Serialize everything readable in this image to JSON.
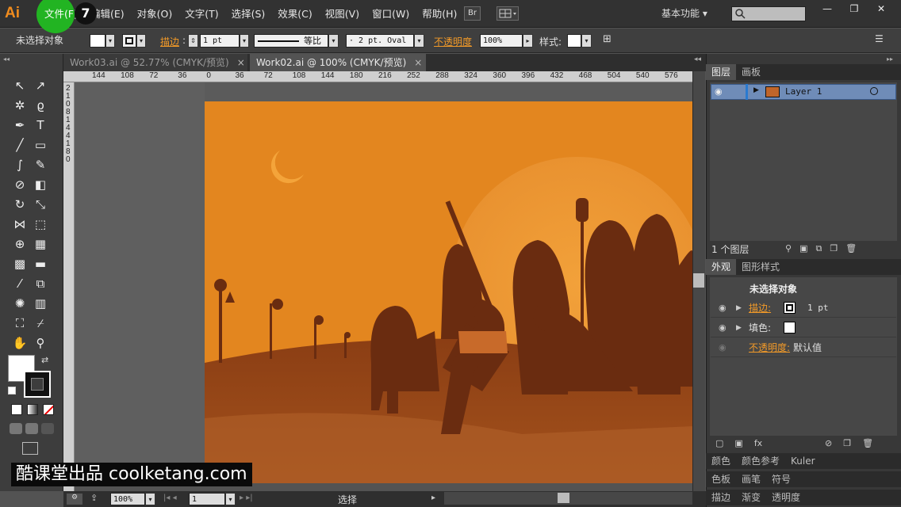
{
  "app": {
    "logo": "Ai",
    "step_badge": "7"
  },
  "menu": [
    "文件(F)",
    "编辑(E)",
    "对象(O)",
    "文字(T)",
    "选择(S)",
    "效果(C)",
    "视图(V)",
    "窗口(W)",
    "帮助(H)"
  ],
  "top_right": {
    "br_label": "Br",
    "workspace": "基本功能",
    "workspace_arrow": "▾",
    "search_placeholder": ""
  },
  "window_controls": {
    "minimize": "—",
    "restore": "❐",
    "close": "✕"
  },
  "control_bar": {
    "selection_state": "未选择对象",
    "stroke_label": "描边",
    "stroke_weight": "1 pt",
    "stroke_profile": "等比",
    "brush": "· 2 pt. Oval",
    "opacity_label": "不透明度",
    "opacity_value": "100%",
    "style_label": "样式:"
  },
  "tabs": [
    {
      "label": "Work03.ai @ 52.77% (CMYK/预览)",
      "close": "×"
    },
    {
      "label": "Work02.ai @ 100% (CMYK/预览)",
      "close": "×"
    }
  ],
  "ruler": {
    "top_ticks": [
      "144",
      "108",
      "72",
      "36",
      "0",
      "36",
      "72",
      "108",
      "144",
      "180",
      "216",
      "252",
      "288",
      "324",
      "360",
      "396",
      "432",
      "468",
      "504",
      "540",
      "576"
    ],
    "left_ticks": [
      "2",
      "1",
      "0",
      "8",
      "1",
      "4",
      "4",
      "1",
      "8",
      "0"
    ]
  },
  "tools": [
    {
      "name": "selection-tool",
      "glyph": "↖"
    },
    {
      "name": "direct-selection-tool",
      "glyph": "↗"
    },
    {
      "name": "magic-wand-tool",
      "glyph": "✲"
    },
    {
      "name": "lasso-tool",
      "glyph": "ϱ"
    },
    {
      "name": "pen-tool",
      "glyph": "✒"
    },
    {
      "name": "type-tool",
      "glyph": "T"
    },
    {
      "name": "line-tool",
      "glyph": "╱"
    },
    {
      "name": "rectangle-tool",
      "glyph": "▭"
    },
    {
      "name": "paintbrush-tool",
      "glyph": "∫"
    },
    {
      "name": "pencil-tool",
      "glyph": "✎"
    },
    {
      "name": "blob-brush-tool",
      "glyph": "⊘"
    },
    {
      "name": "eraser-tool",
      "glyph": "◧"
    },
    {
      "name": "rotate-tool",
      "glyph": "↻"
    },
    {
      "name": "scale-tool",
      "glyph": "⤡"
    },
    {
      "name": "width-tool",
      "glyph": "⋈"
    },
    {
      "name": "free-transform-tool",
      "glyph": "⬚"
    },
    {
      "name": "shape-builder-tool",
      "glyph": "⊕"
    },
    {
      "name": "perspective-grid-tool",
      "glyph": "▦"
    },
    {
      "name": "mesh-tool",
      "glyph": "▩"
    },
    {
      "name": "gradient-tool",
      "glyph": "▬"
    },
    {
      "name": "eyedropper-tool",
      "glyph": "⁄"
    },
    {
      "name": "blend-tool",
      "glyph": "⧉"
    },
    {
      "name": "symbol-sprayer-tool",
      "glyph": "✺"
    },
    {
      "name": "column-graph-tool",
      "glyph": "▥"
    },
    {
      "name": "artboard-tool",
      "glyph": "⛶"
    },
    {
      "name": "slice-tool",
      "glyph": "⌿"
    },
    {
      "name": "hand-tool",
      "glyph": "✋"
    },
    {
      "name": "zoom-tool",
      "glyph": "⚲"
    }
  ],
  "panels": {
    "layers_tabs": [
      "图层",
      "画板"
    ],
    "layer_name": "Layer 1",
    "layers_count": "1 个图层",
    "appearance_tabs": [
      "外观",
      "图形样式"
    ],
    "appearance_title": "未选择对象",
    "appearance_rows": [
      {
        "label": "描边:",
        "value": "1 pt",
        "link": true
      },
      {
        "label": "填色:",
        "value": "",
        "link": false
      },
      {
        "label": "不透明度:",
        "value": "默认值",
        "link": true
      }
    ],
    "color_tabs": [
      "颜色",
      "颜色参考",
      "Kuler"
    ],
    "swatch_tabs": [
      "色板",
      "画笔",
      "符号"
    ],
    "stroke_tabs": [
      "描边",
      "渐变",
      "透明度"
    ]
  },
  "status": {
    "zoom": "100%",
    "artboard_num": "1",
    "tool": "选择"
  },
  "watermark": "酷课堂出品 coolketang.com",
  "colors": {
    "accent_orange": "#f29a28",
    "artboard_orange": "#e3861f",
    "silhouette_brown": "#6a2c10",
    "highlight_green": "#22b422"
  }
}
